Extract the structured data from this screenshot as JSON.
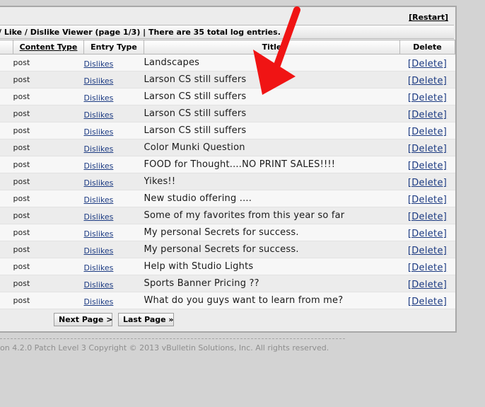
{
  "header": {
    "restart_label": "[Restart]",
    "title": "/ Like / Dislike Viewer (page 1/3) | There are 35 total log entries."
  },
  "table": {
    "columns": [
      "Content Type",
      "Entry Type",
      "Title",
      "Delete"
    ],
    "rows": [
      {
        "content_type": "post",
        "entry_type": "Dislikes",
        "title": "Landscapes",
        "delete": "[Delete]"
      },
      {
        "content_type": "post",
        "entry_type": "Dislikes",
        "title": "Larson CS still suffers",
        "delete": "[Delete]"
      },
      {
        "content_type": "post",
        "entry_type": "Dislikes",
        "title": "Larson CS still suffers",
        "delete": "[Delete]"
      },
      {
        "content_type": "post",
        "entry_type": "Dislikes",
        "title": "Larson CS still suffers",
        "delete": "[Delete]"
      },
      {
        "content_type": "post",
        "entry_type": "Dislikes",
        "title": "Larson CS still suffers",
        "delete": "[Delete]"
      },
      {
        "content_type": "post",
        "entry_type": "Dislikes",
        "title": "Color Munki Question",
        "delete": "[Delete]"
      },
      {
        "content_type": "post",
        "entry_type": "Dislikes",
        "title": "FOOD for Thought....NO PRINT SALES!!!!",
        "delete": "[Delete]"
      },
      {
        "content_type": "post",
        "entry_type": "Dislikes",
        "title": "Yikes!!",
        "delete": "[Delete]"
      },
      {
        "content_type": "post",
        "entry_type": "Dislikes",
        "title": "New studio offering ....",
        "delete": "[Delete]"
      },
      {
        "content_type": "post",
        "entry_type": "Dislikes",
        "title": "Some of my favorites from this year so far",
        "delete": "[Delete]"
      },
      {
        "content_type": "post",
        "entry_type": "Dislikes",
        "title": "My personal Secrets for success.",
        "delete": "[Delete]"
      },
      {
        "content_type": "post",
        "entry_type": "Dislikes",
        "title": "My personal Secrets for success.",
        "delete": "[Delete]"
      },
      {
        "content_type": "post",
        "entry_type": "Dislikes",
        "title": "Help with Studio Lights",
        "delete": "[Delete]"
      },
      {
        "content_type": "post",
        "entry_type": "Dislikes",
        "title": "Sports Banner Pricing ??",
        "delete": "[Delete]"
      },
      {
        "content_type": "post",
        "entry_type": "Dislikes",
        "title": "What do you guys want to learn from me?",
        "delete": "[Delete]"
      }
    ]
  },
  "pager": {
    "next_label": "Next Page >",
    "last_label": "Last Page »"
  },
  "footer": {
    "copyright": "on 4.2.0 Patch Level 3 Copyright © 2013 vBulletin Solutions, Inc. All rights reserved."
  },
  "annotation": {
    "arrow_color": "#f01414",
    "arrow_icon": "red-arrow-icon"
  },
  "colors": {
    "link": "#1b3a82",
    "page_bg": "#d3d3d3"
  }
}
